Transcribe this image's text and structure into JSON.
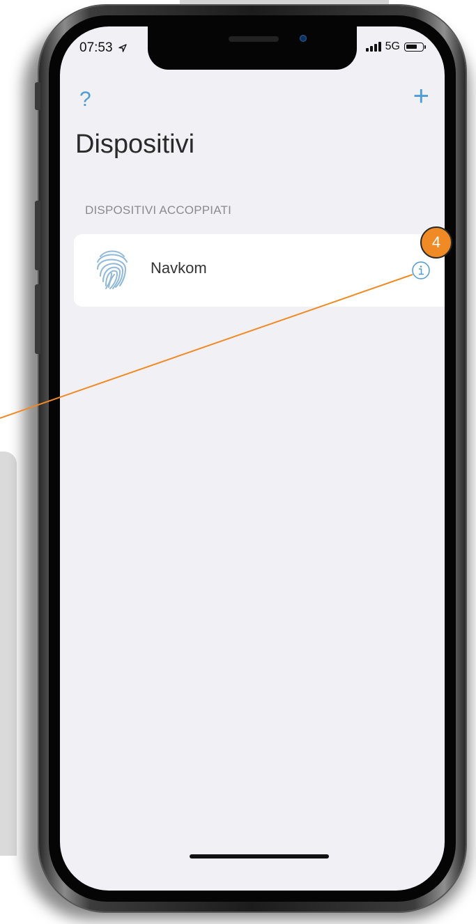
{
  "status_bar": {
    "time": "07:53",
    "network": "5G"
  },
  "nav": {
    "help_label": "?",
    "add_label": "+"
  },
  "page": {
    "title": "Dispositivi",
    "section_header": "DISPOSITIVI ACCOPPIATI"
  },
  "devices": [
    {
      "name": "Navkom",
      "icon": "fingerprint-icon",
      "action_icon": "info-icon"
    }
  ],
  "annotation": {
    "badge": "4"
  },
  "colors": {
    "accent": "#4f9bd6",
    "callout": "#f08a24",
    "screen_bg": "#f0f0f5"
  }
}
